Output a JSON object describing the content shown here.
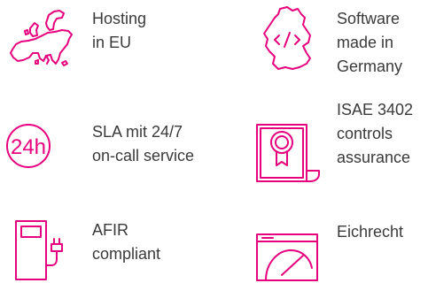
{
  "accent_color": "#e6007e",
  "text_color": "#3a3a3a",
  "features": [
    {
      "icon": "europe-map-icon",
      "lines": [
        "Hosting",
        "in EU"
      ]
    },
    {
      "icon": "germany-code-icon",
      "lines": [
        "Software",
        "made in",
        "Germany"
      ]
    },
    {
      "icon": "24h-icon",
      "lines": [
        "SLA mit 24/7",
        "on-call service"
      ]
    },
    {
      "icon": "certificate-icon",
      "lines": [
        "ISAE 3402",
        "controls",
        "assurance"
      ]
    },
    {
      "icon": "ev-charger-icon",
      "lines": [
        "AFIR",
        "compliant"
      ]
    },
    {
      "icon": "meter-gauge-icon",
      "lines": [
        "Eichrecht"
      ]
    }
  ]
}
